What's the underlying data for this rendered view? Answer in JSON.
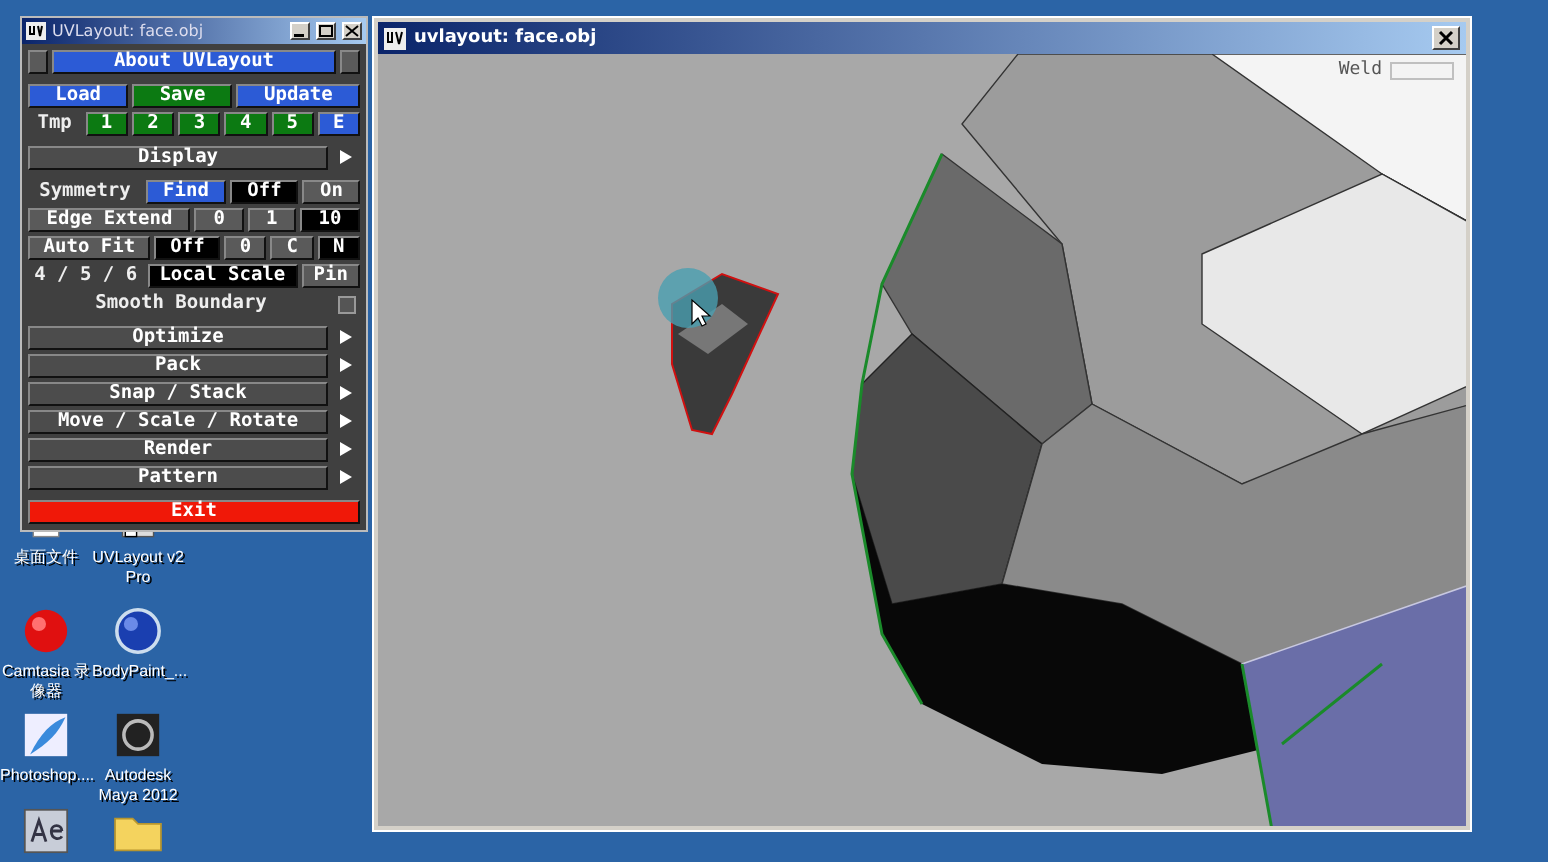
{
  "desktop": {
    "icons": [
      {
        "label": "桌面文件",
        "kind": "file"
      },
      {
        "label": "UVLayout v2 Pro",
        "kind": "app"
      },
      {
        "label": "Camtasia 录像器",
        "kind": "record"
      },
      {
        "label": "BodyPaint_...",
        "kind": "sphere"
      },
      {
        "label": "Photoshop....",
        "kind": "feather"
      },
      {
        "label": "Autodesk Maya 2012",
        "kind": "maya"
      },
      {
        "kind": "ae"
      },
      {
        "kind": "folder"
      }
    ]
  },
  "uv_panel": {
    "title": "UVLayout: face.obj",
    "about": "About UVLayout",
    "toolbars": [
      {
        "items": [
          {
            "kind": "blue",
            "text": "Load"
          },
          {
            "kind": "green",
            "text": "Save"
          },
          {
            "kind": "blue",
            "text": "Update"
          }
        ]
      },
      {
        "items": [
          {
            "kind": "label",
            "text": "Tmp"
          },
          {
            "kind": "green",
            "text": "1"
          },
          {
            "kind": "green",
            "text": "2"
          },
          {
            "kind": "green",
            "text": "3"
          },
          {
            "kind": "green",
            "text": "4"
          },
          {
            "kind": "green",
            "text": "5"
          },
          {
            "kind": "blue",
            "text": "E"
          }
        ]
      },
      {
        "items": [
          {
            "kind": "menu",
            "text": "Display"
          }
        ]
      },
      {
        "items": [
          {
            "kind": "label",
            "text": "Symmetry"
          },
          {
            "kind": "blue",
            "text": "Find"
          },
          {
            "kind": "black",
            "text": "Off"
          },
          {
            "kind": "grey",
            "text": "On"
          }
        ]
      },
      {
        "items": [
          {
            "kind": "grey",
            "text": "Edge Extend"
          },
          {
            "kind": "grey",
            "text": "0"
          },
          {
            "kind": "grey",
            "text": "1"
          },
          {
            "kind": "black",
            "text": "10"
          }
        ]
      },
      {
        "items": [
          {
            "kind": "grey",
            "text": "Auto Fit"
          },
          {
            "kind": "black",
            "text": "Off"
          },
          {
            "kind": "grey",
            "text": "0"
          },
          {
            "kind": "grey",
            "text": "C"
          },
          {
            "kind": "black",
            "text": "N"
          }
        ]
      },
      {
        "items": [
          {
            "kind": "label",
            "text": "4 / 5 / 6"
          },
          {
            "kind": "black",
            "text": "Local Scale"
          },
          {
            "kind": "grey",
            "text": "Pin"
          }
        ]
      },
      {
        "items": [
          {
            "kind": "label",
            "text": "Smooth Boundary"
          },
          {
            "kind": "checkbox",
            "checked": false
          }
        ]
      },
      {
        "items": [
          {
            "kind": "menu",
            "text": "Optimize"
          }
        ]
      },
      {
        "items": [
          {
            "kind": "menu",
            "text": "Pack"
          }
        ]
      },
      {
        "items": [
          {
            "kind": "menu",
            "text": "Snap / Stack"
          }
        ]
      },
      {
        "items": [
          {
            "kind": "menu",
            "text": "Move / Scale / Rotate"
          }
        ]
      },
      {
        "items": [
          {
            "kind": "menu",
            "text": "Render"
          }
        ]
      },
      {
        "items": [
          {
            "kind": "menu",
            "text": "Pattern"
          }
        ]
      },
      {
        "items": [
          {
            "kind": "red",
            "text": "Exit"
          }
        ]
      }
    ]
  },
  "viewport": {
    "title": "uvlayout: face.obj",
    "weld_label": "Weld"
  }
}
